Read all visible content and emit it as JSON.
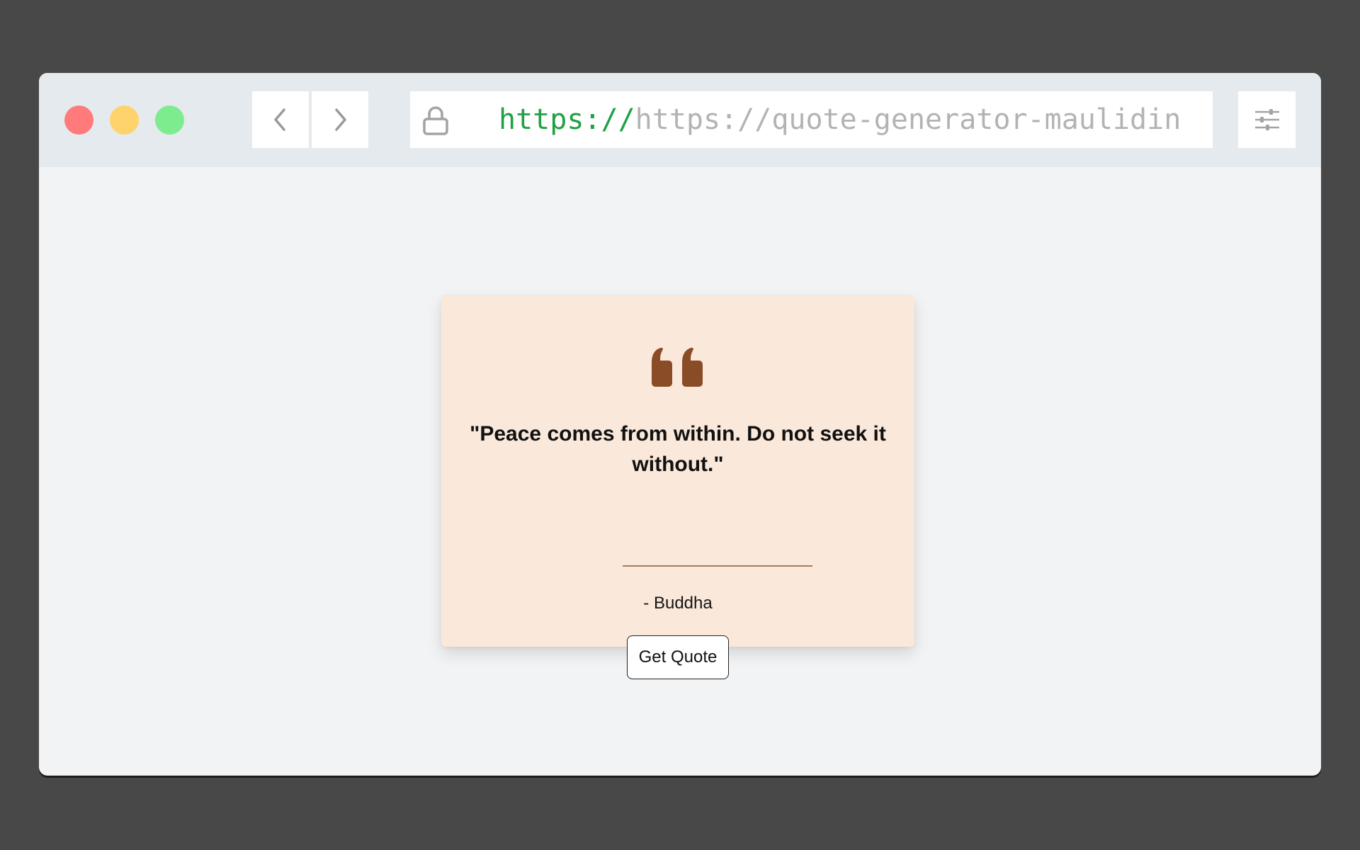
{
  "browser": {
    "url_scheme": "https://",
    "url_rest": "https://quote-generator-maulidin-ilh",
    "traffic_lights": {
      "close_color": "#ff7b7b",
      "minimize_color": "#ffd36b",
      "maximize_color": "#7cec8f"
    },
    "icons": {
      "back": "chevron-left-icon",
      "forward": "chevron-right-icon",
      "lock": "lock-icon",
      "settings": "sliders-icon"
    }
  },
  "quote_card": {
    "icon": "quote-icon",
    "accent_color": "#8a4b27",
    "background_color": "#fae8da",
    "quote": "\"Peace comes from within. Do not seek it without.\"",
    "author": "- Buddha",
    "button_label": "Get Quote"
  }
}
